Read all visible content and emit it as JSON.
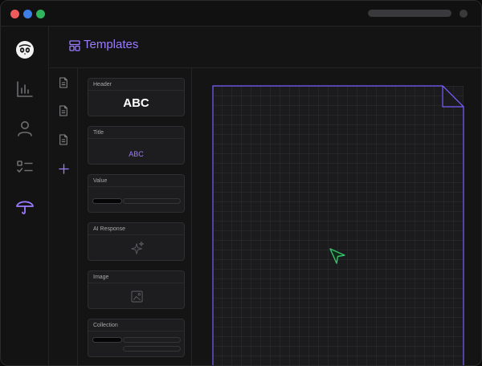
{
  "header": {
    "title": "Templates",
    "icon": "layout-icon"
  },
  "rail": {
    "items": [
      {
        "icon": "owl-logo-icon",
        "active": false
      },
      {
        "icon": "bar-chart-icon",
        "active": false
      },
      {
        "icon": "user-icon",
        "active": false
      },
      {
        "icon": "checklist-icon",
        "active": false
      },
      {
        "icon": "umbrella-icon",
        "active": true
      }
    ]
  },
  "docs": {
    "items": [
      "document-icon",
      "document-icon",
      "document-icon"
    ],
    "add": "plus-icon"
  },
  "palette": {
    "cards": [
      {
        "label": "Header",
        "preview": "ABC"
      },
      {
        "label": "Title",
        "preview": "ABC"
      },
      {
        "label": "Value"
      },
      {
        "label": "AI Response",
        "icon": "sparkle-icon"
      },
      {
        "label": "Image",
        "icon": "image-icon"
      },
      {
        "label": "Collection"
      }
    ]
  },
  "colors": {
    "accent": "#9b7cff",
    "cursor": "#35c46a",
    "sheet_border": "#7a5cff"
  }
}
